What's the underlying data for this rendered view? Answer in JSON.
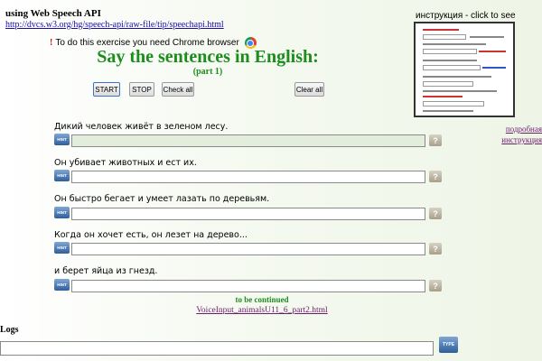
{
  "header": {
    "api_title": "using Web Speech API",
    "api_link": "http://dvcs.w3.org/hg/speech-api/raw-file/tip/speechapi.html",
    "chrome_note_mark": "!",
    "chrome_note": "To do this exercise you need Chrome browser",
    "chrome_icon": "chrome-logo-icon"
  },
  "title": {
    "main": "Say the sentences in English:",
    "part": "(part 1)"
  },
  "colors": {
    "title_green": "#1c8c1c",
    "link_purple": "#6b1c6b",
    "hint_blue": "#2f5e9a"
  },
  "buttons": {
    "start": "START",
    "stop": "STOP",
    "check_all": "Check all",
    "clear_all": "Clear all"
  },
  "instructions": {
    "label": "инструкция - click to see",
    "side_link": "подробная инструкция"
  },
  "exercise": {
    "hint_label": "HINT",
    "check_label": "?",
    "items": [
      {
        "sentence": "Дикий человек живёт в зеленом лесу.",
        "answer": ""
      },
      {
        "sentence": "Он убивает животных и ест их.",
        "answer": ""
      },
      {
        "sentence": "Он быстро бегает и умеет лазать по деревьям.",
        "answer": ""
      },
      {
        "sentence": "Когда он хочет есть, он лезет на дерево...",
        "answer": ""
      },
      {
        "sentence": "и берет яйца из гнезд.",
        "answer": ""
      }
    ]
  },
  "footer": {
    "continued": "to be continued",
    "next_link": "VoiceInput_animalsU11_6_part2.html",
    "logs_label": "Logs",
    "type_button": "TYPE"
  }
}
